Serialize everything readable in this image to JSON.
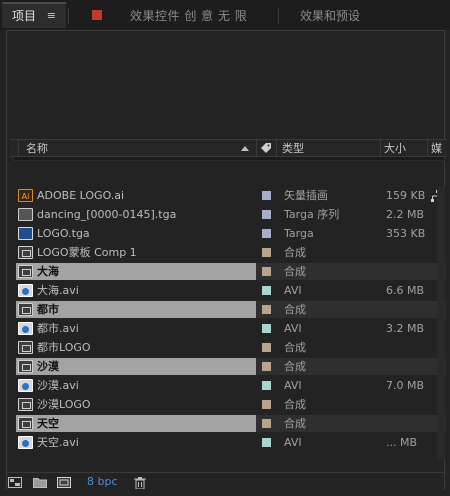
{
  "tabs": {
    "project": "项目",
    "project_menu": "≡",
    "effects": "效果控件 创 意 无 限",
    "presets": "效果和预设"
  },
  "icons": {
    "search": "search-icon",
    "header_label": "label-tag-icon",
    "flowchart": "flowchart-icon",
    "sort": "sort-ascending-icon"
  },
  "columns": {
    "name": "名称",
    "type": "类型",
    "size": "大小",
    "media": "媒"
  },
  "items": [
    {
      "name": "ADOBE LOGO.ai",
      "icon": "ai",
      "label_color": "#a9aec8",
      "type": "矢量插画",
      "size": "159 KB",
      "folder": false
    },
    {
      "name": "dancing_[0000-0145].tga",
      "icon": "tga",
      "label_color": "#a9aec8",
      "type": "Targa 序列",
      "size": "2.2 MB",
      "folder": false
    },
    {
      "name": "LOGO.tga",
      "icon": "logo",
      "label_color": "#a9aec8",
      "type": "Targa",
      "size": "353 KB",
      "folder": false
    },
    {
      "name": "LOGO蒙板 Comp 1",
      "icon": "comp",
      "label_color": "#b8a48c",
      "type": "合成",
      "size": "",
      "folder": false
    },
    {
      "name": "大海",
      "icon": "comp",
      "label_color": "#b8a48c",
      "type": "合成",
      "size": "",
      "folder": true
    },
    {
      "name": "大海.avi",
      "icon": "avi",
      "label_color": "#a9d3cf",
      "type": "AVI",
      "size": "6.6 MB",
      "folder": false
    },
    {
      "name": "都市",
      "icon": "comp",
      "label_color": "#b8a48c",
      "type": "合成",
      "size": "",
      "folder": true
    },
    {
      "name": "都市.avi",
      "icon": "avi",
      "label_color": "#a9d3cf",
      "type": "AVI",
      "size": "3.2 MB",
      "folder": false
    },
    {
      "name": "都市LOGO",
      "icon": "comp",
      "label_color": "#b8a48c",
      "type": "合成",
      "size": "",
      "folder": false
    },
    {
      "name": "沙漠",
      "icon": "comp",
      "label_color": "#b8a48c",
      "type": "合成",
      "size": "",
      "folder": true
    },
    {
      "name": "沙漠.avi",
      "icon": "avi",
      "label_color": "#a9d3cf",
      "type": "AVI",
      "size": "7.0 MB",
      "folder": false
    },
    {
      "name": "沙漠LOGO",
      "icon": "comp",
      "label_color": "#b8a48c",
      "type": "合成",
      "size": "",
      "folder": false
    },
    {
      "name": "天空",
      "icon": "comp",
      "label_color": "#b8a48c",
      "type": "合成",
      "size": "",
      "folder": true
    },
    {
      "name": "天空.avi",
      "icon": "avi",
      "label_color": "#a9d3cf",
      "type": "AVI",
      "size": "... MB",
      "folder": false
    }
  ],
  "footer": {
    "bpc": "8 bpc"
  },
  "colors": {
    "record": "#c0392b",
    "bpc_accent": "#4d8fd6"
  }
}
